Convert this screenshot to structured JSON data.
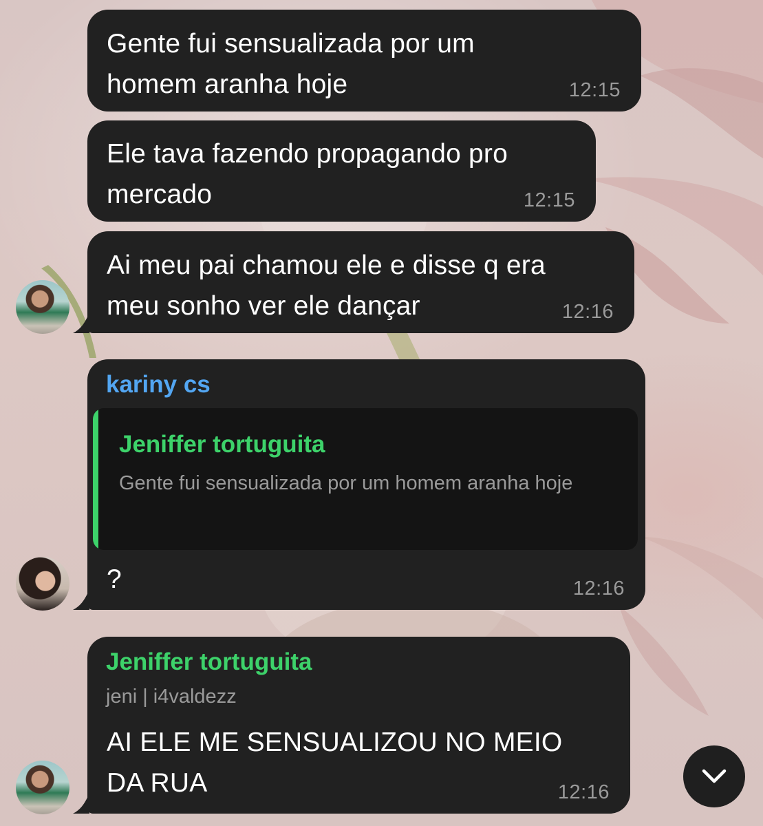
{
  "chat": {
    "messages": [
      {
        "text": "Gente fui sensualizada por um\nhomem aranha hoje",
        "time": "12:15"
      },
      {
        "text": "Ele tava fazendo propagando pro\nmercado",
        "time": "12:15"
      },
      {
        "text": "Ai meu pai chamou ele e disse q era\nmeu sonho ver ele dançar",
        "time": "12:16"
      },
      {
        "sender": "kariny cs",
        "reply": {
          "name": "Jeniffer tortuguita",
          "text": "Gente fui sensualizada por um homem aranha hoje"
        },
        "text": "?",
        "time": "12:16"
      },
      {
        "sender": "Jeniffer tortuguita",
        "subtitle": "jeni | i4valdezz",
        "text": "AI ELE ME SENSUALIZOU NO MEIO\nDA RUA",
        "time": "12:16"
      }
    ]
  },
  "colors": {
    "bubble": "#212121",
    "sender_blue": "#53a6f2",
    "sender_green": "#3dd26a",
    "timestamp": "#9a9a9a"
  },
  "icons": {
    "scroll_down": "chevron-down-icon"
  }
}
